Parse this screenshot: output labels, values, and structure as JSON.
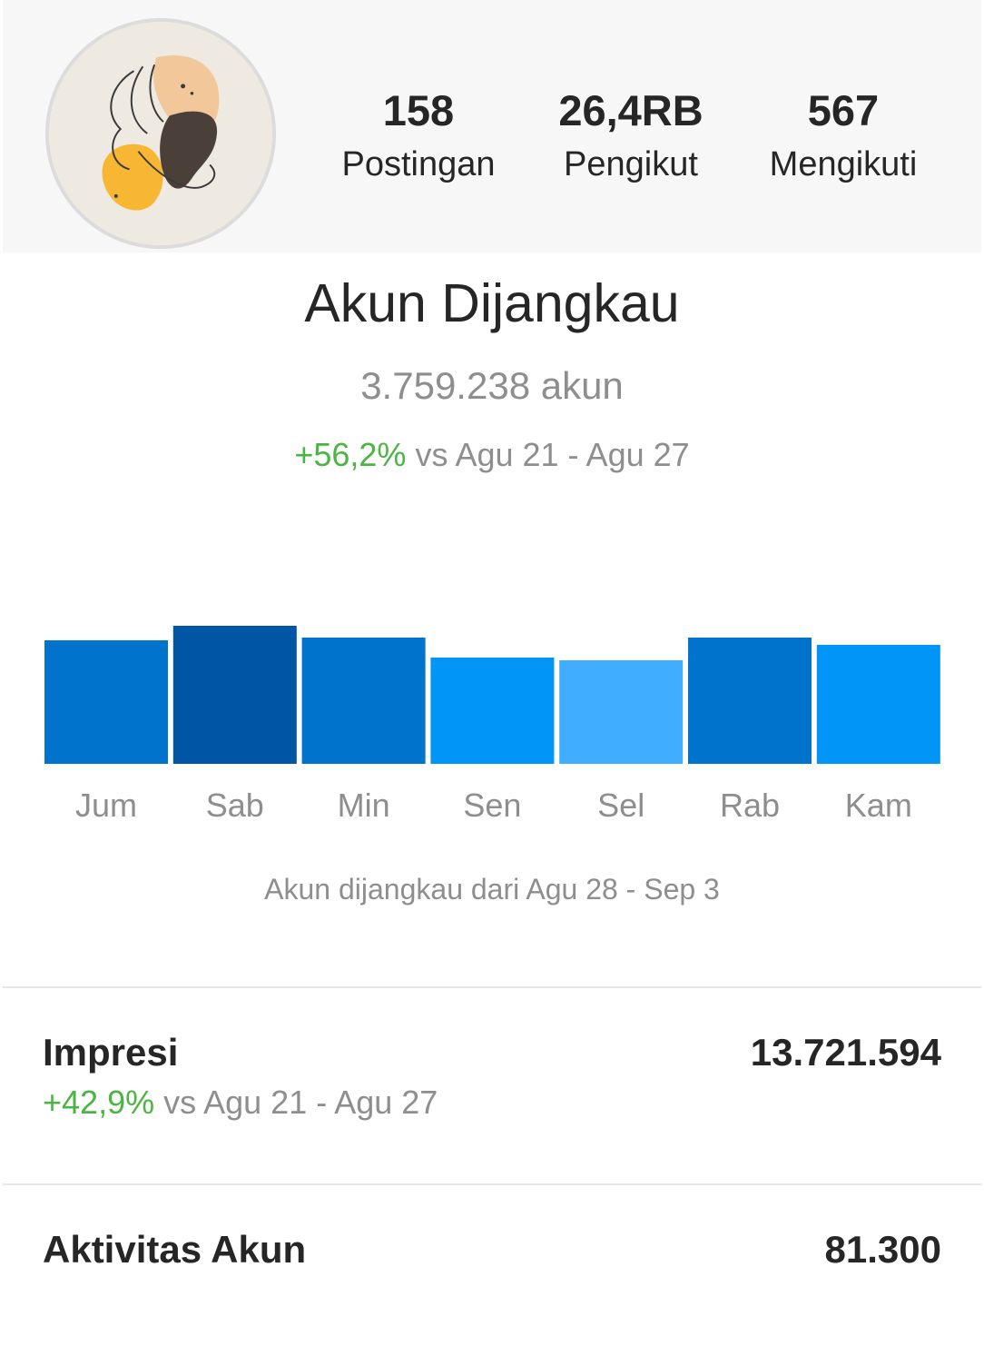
{
  "profile": {
    "stats": [
      {
        "value": "158",
        "label": "Postingan"
      },
      {
        "value": "26,4RB",
        "label": "Pengikut"
      },
      {
        "value": "567",
        "label": "Mengikuti"
      }
    ]
  },
  "reach": {
    "title": "Akun Dijangkau",
    "value": "3.759.238 akun",
    "delta_percent": "+56,2%",
    "delta_text": " vs Agu 21 - Agu 27",
    "caption": "Akun dijangkau dari Agu 28 - Sep 3"
  },
  "chart_data": {
    "type": "bar",
    "categories": [
      "Jum",
      "Sab",
      "Min",
      "Sen",
      "Sel",
      "Rab",
      "Kam"
    ],
    "values": [
      136,
      152,
      139,
      117,
      114,
      139,
      131
    ],
    "colors": [
      "#0073cc",
      "#0055a5",
      "#0073cc",
      "#0095f6",
      "#41adff",
      "#0073cc",
      "#0095f6"
    ],
    "ylim": [
      0,
      152
    ],
    "grid": false,
    "xlabel": "",
    "ylabel": ""
  },
  "metrics": [
    {
      "label": "Impresi",
      "value": "13.721.594",
      "delta_percent": "+42,9%",
      "delta_text": " vs Agu 21 - Agu 27"
    },
    {
      "label": "Aktivitas Akun",
      "value": "81.300"
    }
  ],
  "colors": {
    "positive": "#4bb543",
    "muted": "#8e8e8e",
    "text": "#262626"
  }
}
